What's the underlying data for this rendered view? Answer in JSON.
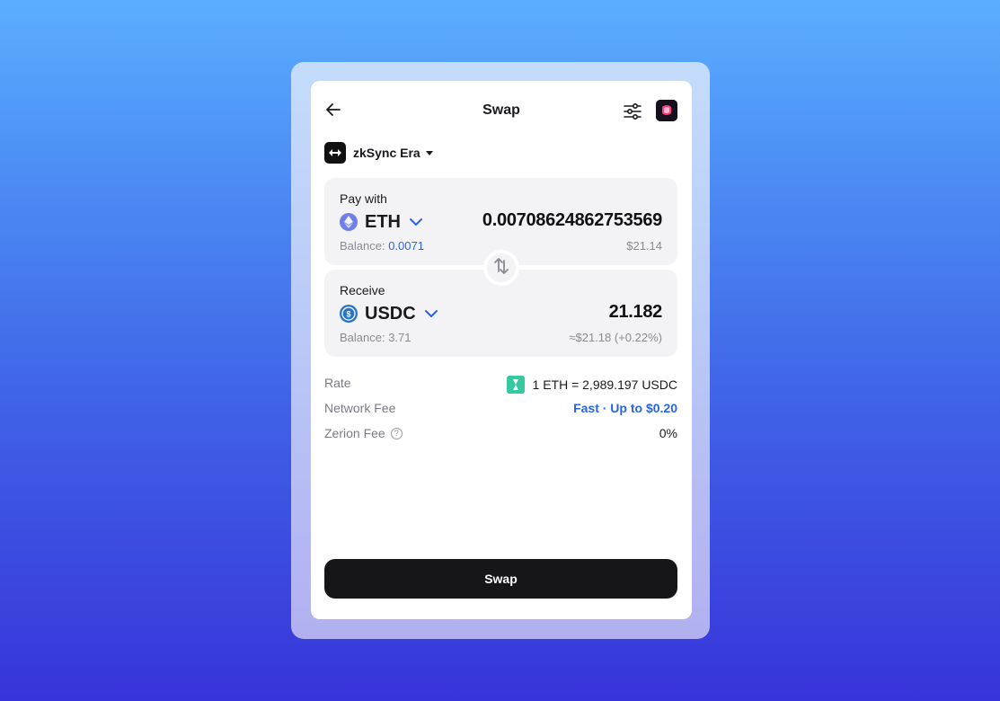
{
  "header": {
    "title": "Swap",
    "back_icon": "arrow-left-icon",
    "settings_icon": "sliders-icon",
    "avatar_icon": "wallet-avatar-icon"
  },
  "network": {
    "name": "zkSync Era",
    "icon": "zksync-logo-icon"
  },
  "pay": {
    "label": "Pay with",
    "token_symbol": "ETH",
    "token_icon": "eth-icon",
    "amount": "0.00708624862753569",
    "balance_label": "Balance:",
    "balance_value": "0.0071",
    "fiat": "$21.14"
  },
  "receive": {
    "label": "Receive",
    "token_symbol": "USDC",
    "token_icon": "usdc-icon",
    "amount": "21.182",
    "balance_label": "Balance: 3.71",
    "fiat": "≈$21.18 (+0.22%)"
  },
  "details": {
    "rate_label": "Rate",
    "rate_value": "1 ETH = 2,989.197 USDC",
    "network_fee_label": "Network Fee",
    "network_fee_value": "Fast · Up to $0.20",
    "zerion_fee_label": "Zerion Fee",
    "zerion_fee_value": "0%"
  },
  "actions": {
    "swap_label": "Swap"
  },
  "colors": {
    "accent": "#2a62e6",
    "button": "#16161a",
    "card": "#f3f3f5"
  }
}
